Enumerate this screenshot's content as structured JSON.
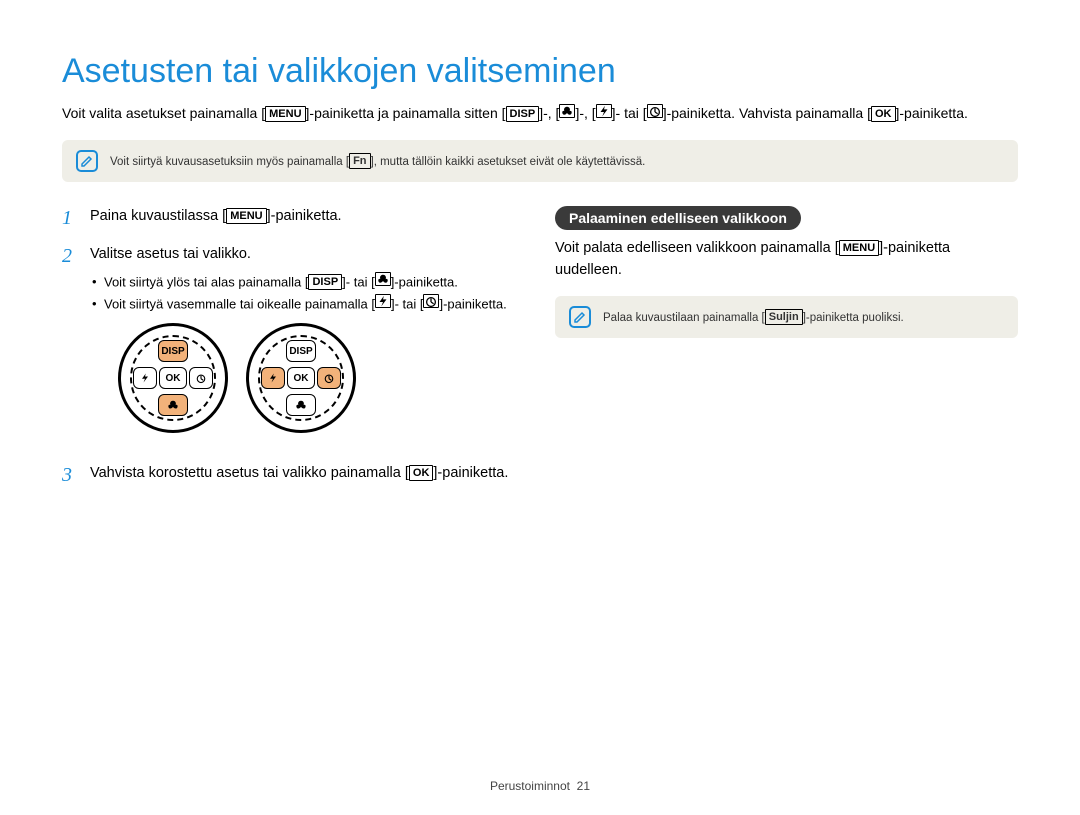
{
  "title": "Asetusten tai valikkojen valitseminen",
  "intro": {
    "part1": "Voit valita asetukset painamalla [",
    "menu": "MENU",
    "part2": "]-painiketta ja painamalla sitten [",
    "disp": "DISP",
    "part3": "]-, [",
    "part4": "]-, [",
    "part5": "]- tai [",
    "part6": "]-painiketta. Vahvista painamalla [",
    "ok": "OK",
    "part7": "]-painiketta."
  },
  "note1": {
    "pre": "Voit siirtyä kuvausasetuksiin myös painamalla [",
    "fn": "Fn",
    "post": "], mutta tällöin kaikki asetukset eivät ole käytettävissä."
  },
  "steps": {
    "s1": {
      "num": "1",
      "pre": "Paina kuvaustilassa [",
      "menu": "MENU",
      "post": "]-painiketta."
    },
    "s2": {
      "num": "2",
      "text": "Valitse asetus tai valikko.",
      "b1": {
        "pre": "Voit siirtyä ylös tai alas painamalla [",
        "disp": "DISP",
        "mid": "]- tai [",
        "post": "]-painiketta."
      },
      "b2": {
        "pre": "Voit siirtyä vasemmalle tai oikealle painamalla [",
        "mid": "]- tai [",
        "post": "]-painiketta."
      }
    },
    "s3": {
      "num": "3",
      "pre": "Vahvista korostettu asetus tai valikko painamalla [",
      "ok": "OK",
      "post": "]-painiketta."
    }
  },
  "dial_labels": {
    "disp": "DISP",
    "ok": "OK"
  },
  "right": {
    "pill": "Palaaminen edelliseen valikkoon",
    "para_pre": "Voit palata edelliseen valikkoon painamalla [",
    "menu": "MENU",
    "para_post": "]-painiketta uudelleen.",
    "note_pre": "Palaa kuvaustilaan painamalla [",
    "suljin": "Suljin",
    "note_post": "]-painiketta puoliksi."
  },
  "footer": {
    "label": "Perustoiminnot",
    "page": "21"
  },
  "icons": {
    "macro": "macro-icon",
    "flash": "flash-icon",
    "timer": "timer-icon",
    "note": "note-icon"
  }
}
